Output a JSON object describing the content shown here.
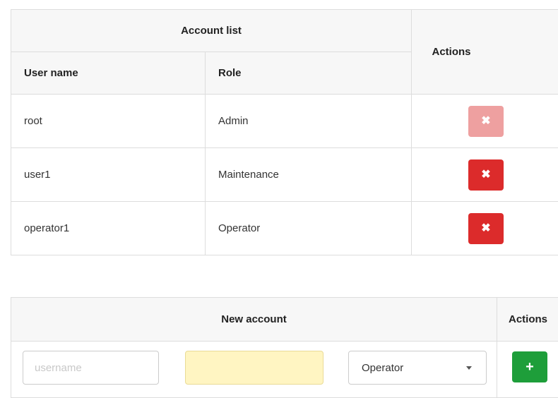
{
  "account_list": {
    "title": "Account list",
    "actions_header": "Actions",
    "columns": [
      "User name",
      "Role"
    ],
    "rows": [
      {
        "username": "root",
        "role": "Admin",
        "delete_icon": "✖",
        "delete_enabled": false
      },
      {
        "username": "user1",
        "role": "Maintenance",
        "delete_icon": "✖",
        "delete_enabled": true
      },
      {
        "username": "operator1",
        "role": "Operator",
        "delete_icon": "✖",
        "delete_enabled": true
      }
    ]
  },
  "new_account": {
    "title": "New account",
    "actions_header": "Actions",
    "username_placeholder": "username",
    "password_value": "",
    "role_selected": "Operator",
    "add_icon": "+"
  },
  "colors": {
    "delete": "#dc2b2b",
    "delete_disabled": "#eea0a0",
    "add": "#1e9e3a",
    "password_bg": "#fff5c2"
  }
}
